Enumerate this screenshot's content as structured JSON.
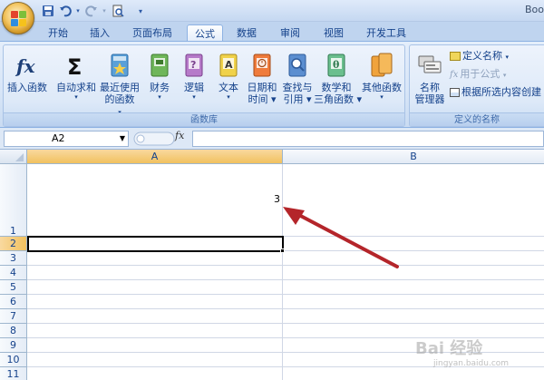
{
  "app": {
    "title": "Boo"
  },
  "tabs": [
    {
      "label": "开始"
    },
    {
      "label": "插入"
    },
    {
      "label": "页面布局"
    },
    {
      "label": "公式"
    },
    {
      "label": "数据"
    },
    {
      "label": "审阅"
    },
    {
      "label": "视图"
    },
    {
      "label": "开发工具"
    }
  ],
  "active_tab": "公式",
  "ribbon": {
    "function_library": {
      "caption": "函数库",
      "insert_function": {
        "label": "插入函数",
        "icon": "fx-icon"
      },
      "autosum": {
        "label1": "自动求和",
        "icon": "sigma-icon"
      },
      "recent": {
        "label1": "最近使用",
        "label2": "的函数",
        "icon": "recent-book-icon"
      },
      "financial": {
        "label1": "财务",
        "icon": "financial-book-icon"
      },
      "logical": {
        "label1": "逻辑",
        "icon": "logical-book-icon"
      },
      "text": {
        "label1": "文本",
        "icon": "text-book-icon"
      },
      "datetime": {
        "label1": "日期和",
        "label2": "时间",
        "icon": "datetime-book-icon"
      },
      "lookup": {
        "label1": "查找与",
        "label2": "引用",
        "icon": "lookup-book-icon"
      },
      "math": {
        "label1": "数学和",
        "label2": "三角函数",
        "icon": "math-book-icon"
      },
      "more": {
        "label1": "其他函数",
        "icon": "more-functions-book-icon"
      }
    },
    "defined_names": {
      "caption": "定义的名称",
      "name_manager": {
        "label1": "名称",
        "label2": "管理器",
        "icon": "name-manager-icon"
      },
      "define_name": {
        "label": "定义名称",
        "icon": "define-name-icon"
      },
      "use_in_formula": {
        "label": "用于公式",
        "icon": "use-in-formula-icon"
      },
      "create_from_selection": {
        "label": "根据所选内容创建",
        "icon": "create-from-selection-icon"
      }
    }
  },
  "formula_bar": {
    "name_box": "A2",
    "fx_label": "fx",
    "formula": ""
  },
  "sheet": {
    "columns": [
      "A",
      "B"
    ],
    "rows": [
      "1",
      "2",
      "3",
      "4",
      "5",
      "6",
      "7",
      "8",
      "9",
      "10",
      "11"
    ],
    "selected_cell": "A2",
    "cells": {
      "A1": "3"
    }
  },
  "watermark": {
    "text": "Bai 经验",
    "sub": "jingyan.baidu.com"
  },
  "colors": {
    "arrow": "#b4252a",
    "selection_header": "#f1c15f",
    "ribbon": "#dde9f8"
  }
}
